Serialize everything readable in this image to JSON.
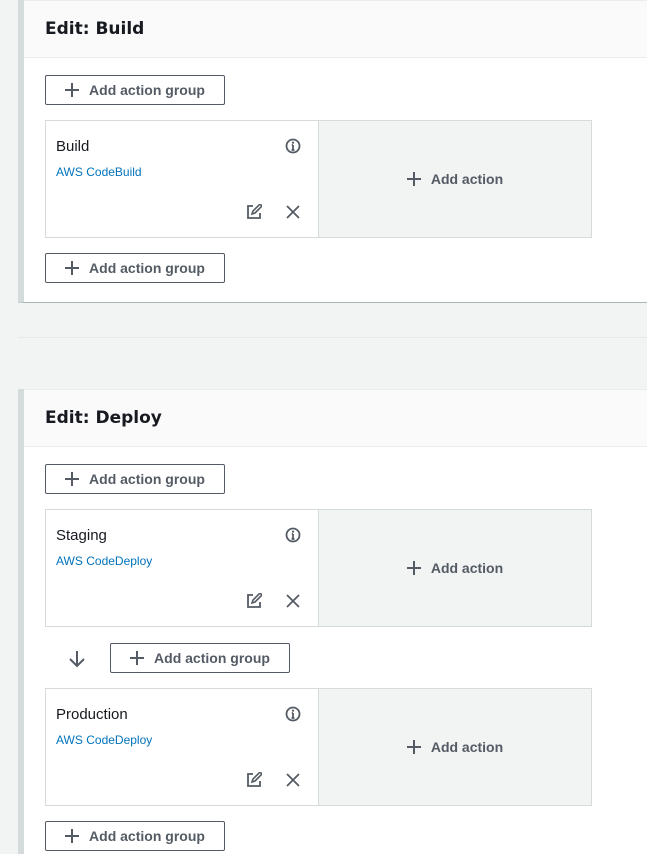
{
  "stages": [
    {
      "title": "Edit: Build",
      "add_group_top": "Add action group",
      "groups": [
        {
          "action_name": "Build",
          "provider": "AWS CodeBuild",
          "add_action": "Add action"
        }
      ],
      "add_group_bottom": "Add action group"
    },
    {
      "title": "Edit: Deploy",
      "add_group_top": "Add action group",
      "groups": [
        {
          "action_name": "Staging",
          "provider": "AWS CodeDeploy",
          "add_action": "Add action"
        },
        {
          "action_name": "Production",
          "provider": "AWS CodeDeploy",
          "add_action": "Add action"
        }
      ],
      "add_group_between": "Add action group",
      "add_group_bottom": "Add action group"
    }
  ],
  "colors": {
    "link": "#0073bb",
    "button_text": "#545b64",
    "panel_border": "#d5dbdb",
    "background": "#f2f3f3"
  },
  "icons": [
    "plus-icon",
    "info-icon",
    "edit-icon",
    "close-icon",
    "arrow-down-icon"
  ]
}
